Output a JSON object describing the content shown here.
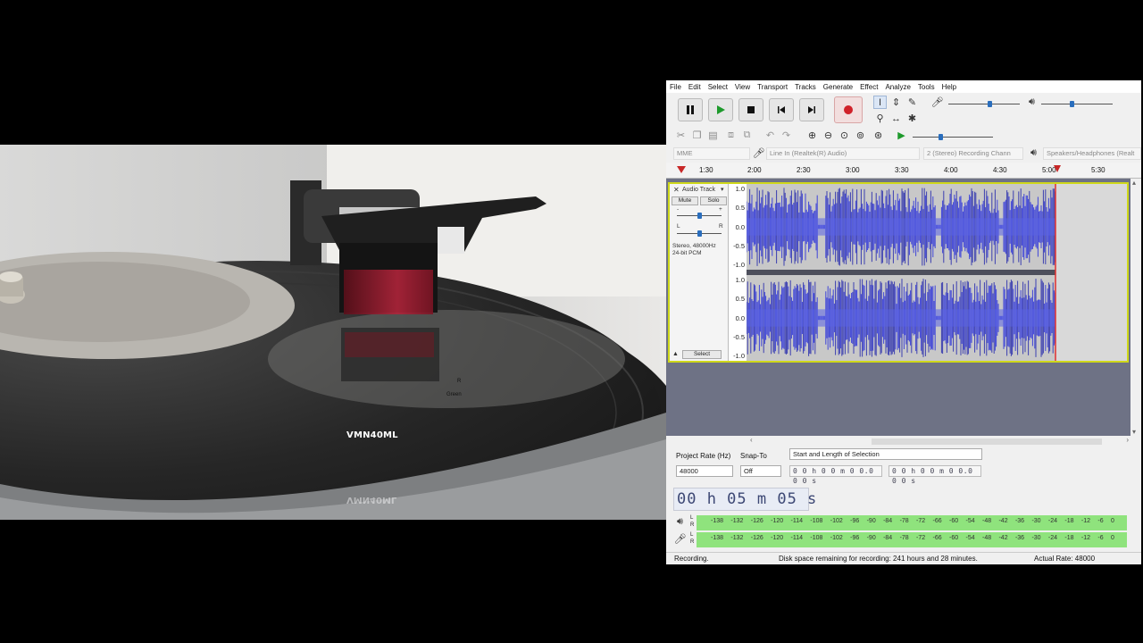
{
  "photo": {
    "cartridge_label": "VMN40ML",
    "headshell_text": [
      "R",
      "Green"
    ]
  },
  "menu": [
    "File",
    "Edit",
    "Select",
    "View",
    "Transport",
    "Tracks",
    "Generate",
    "Effect",
    "Analyze",
    "Tools",
    "Help"
  ],
  "devices": {
    "host": "MME",
    "input": "Line In (Realtek(R) Audio)",
    "channels": "2 (Stereo) Recording Chann",
    "output": "Speakers/Headphones (Realt"
  },
  "ruler": {
    "ticks": [
      "1:30",
      "2:00",
      "2:30",
      "3:00",
      "3:30",
      "4:00",
      "4:30",
      "5:00",
      "5:30"
    ]
  },
  "track": {
    "name": "Audio Track",
    "mute": "Mute",
    "solo": "Solo",
    "gain_min": "-",
    "gain_max": "+",
    "pan_left": "L",
    "pan_right": "R",
    "info_line1": "Stereo, 48000Hz",
    "info_line2": "24-bit PCM",
    "select": "Select",
    "scale": [
      "1.0",
      "0.5",
      "0.0",
      "-0.5",
      "-1.0"
    ]
  },
  "selection": {
    "project_rate_label": "Project Rate (Hz)",
    "project_rate": "48000",
    "snap_label": "Snap-To",
    "snap": "Off",
    "mode": "Start and Length of Selection",
    "start": "0 0 h 0 0 m 0 0.0 0 0 s",
    "length": "0 0 h 0 0 m 0 0.0 0 0 s"
  },
  "time_display": "00 h 05 m 05 s",
  "meters": {
    "scale": [
      "-138",
      "-132",
      "-126",
      "-120",
      "-114",
      "-108",
      "-102",
      "-96",
      "-90",
      "-84",
      "-78",
      "-72",
      "-66",
      "-60",
      "-54",
      "-48",
      "-42",
      "-36",
      "-30",
      "-24",
      "-18",
      "-12",
      "-6",
      "0"
    ],
    "channels": [
      "L",
      "R"
    ]
  },
  "status": {
    "state": "Recording.",
    "disk": "Disk space remaining for recording: 241 hours and 28 minutes.",
    "rate": "Actual Rate: 48000"
  }
}
